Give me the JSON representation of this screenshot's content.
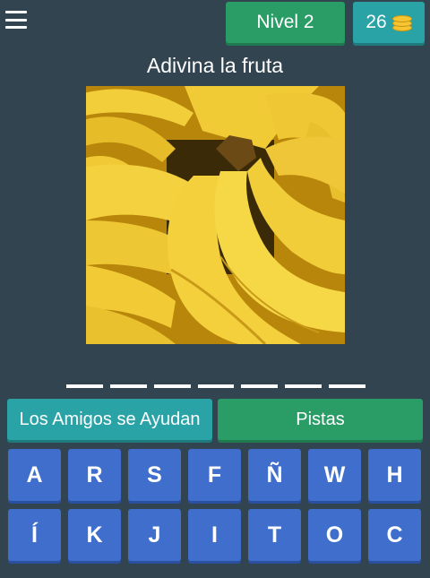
{
  "header": {
    "level_label": "Nivel 2",
    "coins": "26"
  },
  "title": "Adivina la fruta",
  "answer": {
    "letter_count": 7
  },
  "buttons": {
    "help_friends": "Los Amigos se Ayudan",
    "hints": "Pistas"
  },
  "keyboard": {
    "rows": [
      [
        "A",
        "R",
        "S",
        "F",
        "Ñ",
        "W",
        "H"
      ],
      [
        "Í",
        "K",
        "J",
        "I",
        "T",
        "O",
        "C"
      ]
    ]
  },
  "colors": {
    "background": "#334451",
    "green": "#2a9d67",
    "teal": "#2aa3a6",
    "key_blue": "#3f6ecc"
  }
}
